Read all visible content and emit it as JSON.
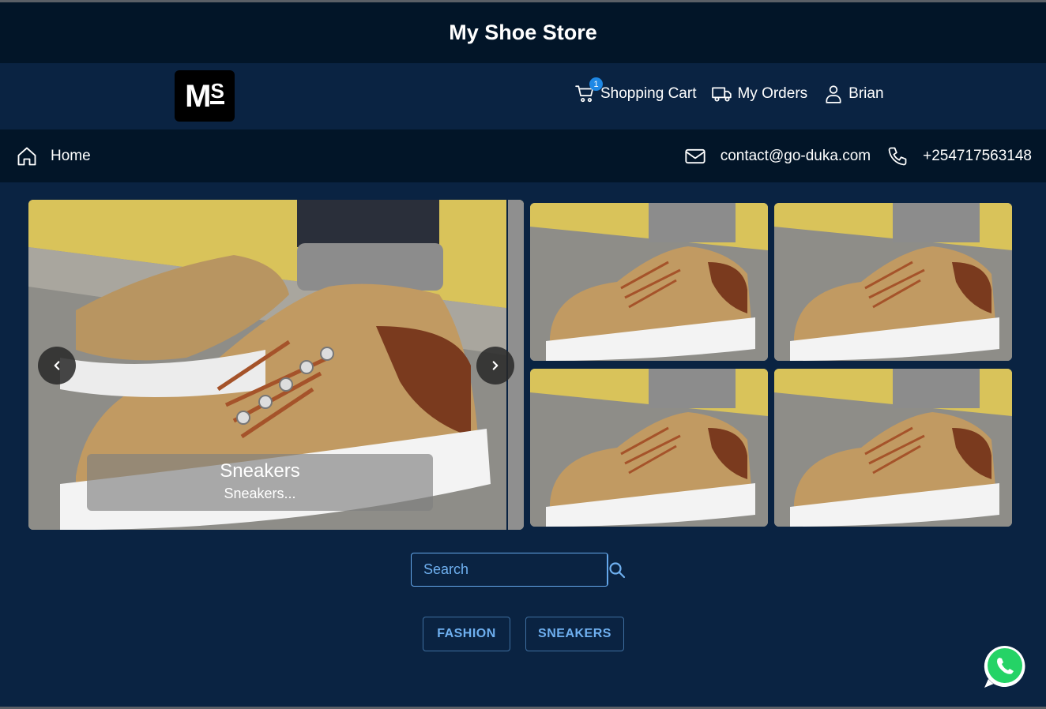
{
  "store": {
    "title": "My Shoe Store"
  },
  "logo": {
    "text_m": "M",
    "text_s": "S"
  },
  "header": {
    "cart_label": "Shopping Cart",
    "cart_count": "1",
    "orders_label": "My Orders",
    "user_label": "Brian"
  },
  "subnav": {
    "home_label": "Home",
    "email": "contact@go-duka.com",
    "phone": "+254717563148"
  },
  "carousel": {
    "caption_title": "Sneakers",
    "caption_subtitle": "Sneakers..."
  },
  "search": {
    "placeholder": "Search"
  },
  "categories": [
    "FASHION",
    "SNEAKERS"
  ],
  "colors": {
    "background": "#0a2342",
    "bar": "#021528",
    "accent": "#6fb0f0",
    "badge": "#1e88e5",
    "whatsapp": "#25d366"
  }
}
